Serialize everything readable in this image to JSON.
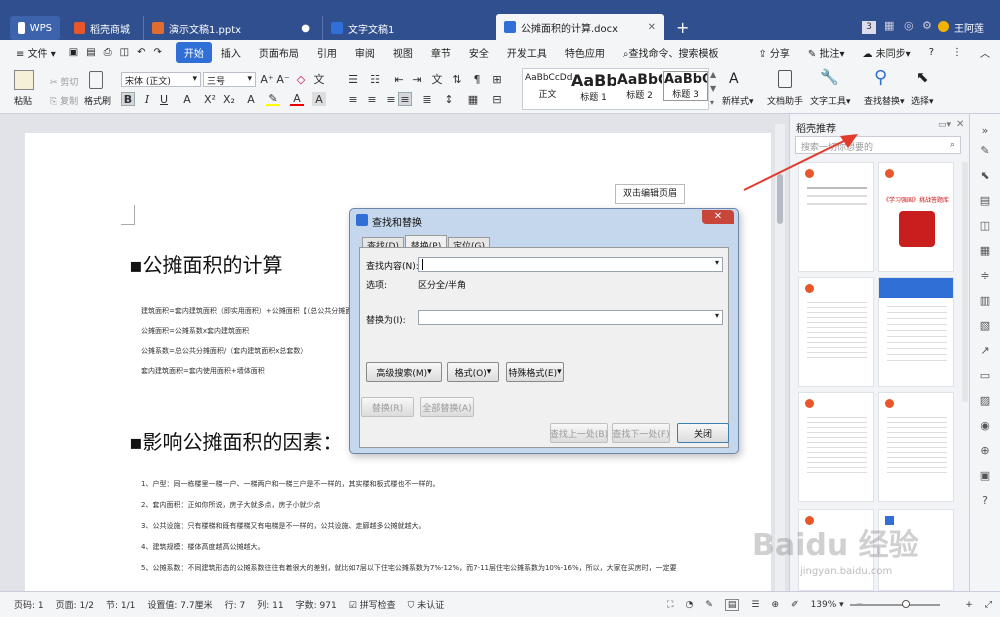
{
  "tabs": [
    {
      "label": "WPS"
    },
    {
      "label": "稻壳商城"
    },
    {
      "label": "演示文稿1.pptx"
    },
    {
      "label": "文字文稿1"
    },
    {
      "label": "公摊面积的计算.docx"
    }
  ],
  "titlebar": {
    "page_badge": "3",
    "user": "王阿莲"
  },
  "menu": {
    "file": "文件",
    "items": [
      "开始",
      "插入",
      "页面布局",
      "引用",
      "审阅",
      "视图",
      "章节",
      "安全",
      "开发工具",
      "特色应用"
    ],
    "search": "查找命令、搜索模板",
    "share": "分享",
    "comment": "批注",
    "sync": "未同步"
  },
  "ribbon": {
    "paste": "粘贴",
    "cut": "剪切",
    "copy": "复制",
    "format_painter": "格式刷",
    "font_name": "宋体 (正文)",
    "font_size": "三号",
    "styles": [
      {
        "sample": "AaBbCcDd",
        "name": "正文"
      },
      {
        "sample": "AaBb",
        "name": "标题 1"
      },
      {
        "sample": "AaBbC",
        "name": "标题 2"
      },
      {
        "sample": "AaBbC",
        "name": "标题 3"
      }
    ],
    "new_style": "新样式",
    "doc_assistant": "文档助手",
    "text_tools": "文字工具",
    "find_replace": "查找替换",
    "select": "选择"
  },
  "document": {
    "header_btn": "双击编辑页眉",
    "heading1": "▪公摊面积的计算",
    "heading2": "▪影响公摊面积的因素：",
    "para1": [
      "建筑面积=套内建筑面积（即实用面积）+公摊面积【（总公共分摊面积）",
      "公摊面积=公摊系数x套内建筑面积",
      "公摊系数=总公共分摊面积/（套内建筑面积x总套数）",
      "套内建筑面积=套内使用面积+墙体面积"
    ],
    "para2": [
      "1、户型：同一栋楼里一梯一户、一梯两户和一梯三户是不一样的，其实楼和板式楼也不一样的。",
      "2、套内面积：正如你所说，房子大就多点，房子小就少点",
      "3、公共设施：只有楼梯和既有楼梯又有电梯是不一样的，公共设施、走廊越多公摊就越大。",
      "4、建筑规模：楼体高度越高公摊越大。",
      "5、公摊系数：不同建筑形态的公摊系数往往有着很大的差别，就比如7层以下住宅公摊系数为7%-12%，而7-11层住宅公摊系数为10%-16%，所以，大家在买房时，一定要"
    ]
  },
  "pane": {
    "title": "稻壳推荐",
    "search_placeholder": "搜索一切你想要的",
    "thumbs": [
      "",
      "《学习强国》挑战答题库",
      "",
      "",
      "",
      "",
      "",
      ""
    ]
  },
  "dialog": {
    "title": "查找和替换",
    "tabs": [
      "查找(D)",
      "替换(P)",
      "定位(G)"
    ],
    "find_label": "查找内容(N):",
    "options_label": "选项:",
    "options_value": "区分全/半角",
    "replace_label": "替换为(I):",
    "adv_search": "高级搜索(M)",
    "format": "格式(O)",
    "special": "特殊格式(E)",
    "replace": "替换(R)",
    "replace_all": "全部替换(A)",
    "find_prev": "查找上一处(B)",
    "find_next": "查找下一处(F)",
    "close": "关闭"
  },
  "status": {
    "items": [
      "页码: 1",
      "页面: 1/2",
      "节: 1/1",
      "设置值: 7.7厘米",
      "行: 7",
      "列: 11",
      "字数: 971",
      "拼写检查",
      "未认证"
    ],
    "zoom": "139%"
  },
  "watermark": "Baidu 经验",
  "watermark_sub": "jingyan.baidu.com",
  "colors": {
    "accent": "#2f6fd6",
    "titlebar": "#2f4f8f",
    "arrow": "#e23b2e"
  }
}
